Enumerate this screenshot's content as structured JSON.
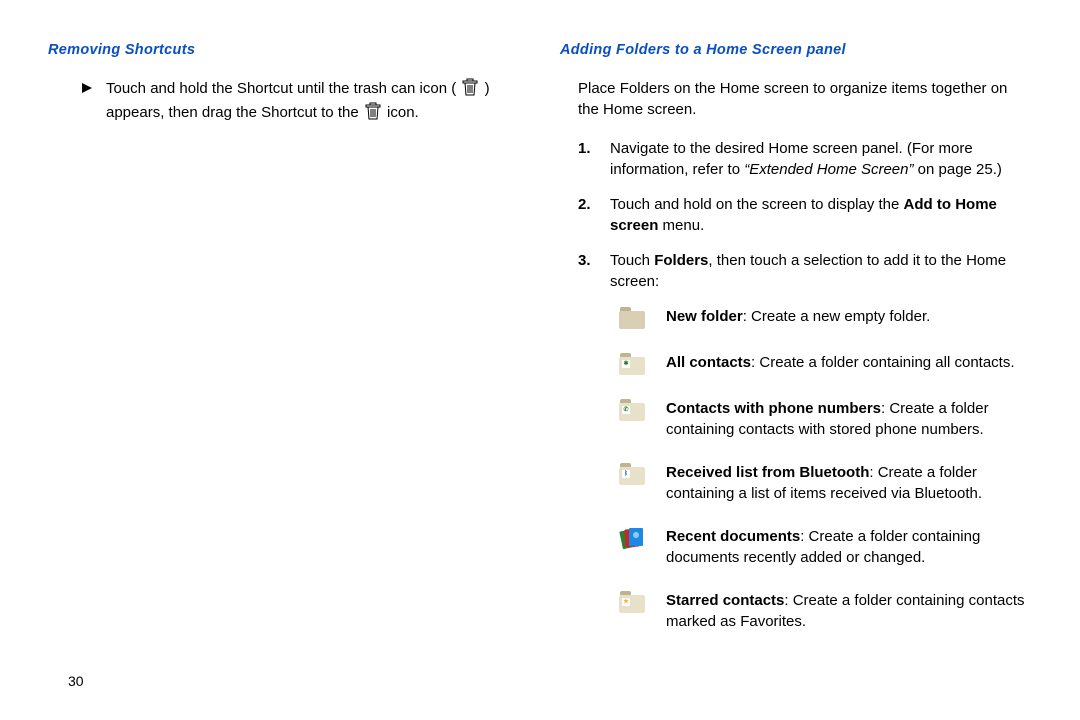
{
  "page_number": "30",
  "left": {
    "heading": "Removing Shortcuts",
    "bullet": {
      "pre": "Touch and hold the Shortcut until the trash can icon (",
      "mid": ") appears, then drag the Shortcut to the",
      "post": " icon."
    }
  },
  "right": {
    "heading": "Adding Folders to a Home Screen panel",
    "intro": "Place Folders on the Home screen to organize items together on the Home screen.",
    "steps": [
      {
        "num": "1.",
        "pre": "Navigate to the desired Home screen panel. (For more information, refer to ",
        "ref": "“Extended Home Screen”",
        "post": " on page 25.)"
      },
      {
        "num": "2.",
        "pre": "Touch and hold on the screen to display the ",
        "bold": "Add to Home screen",
        "post": " menu."
      },
      {
        "num": "3.",
        "pre": "Touch ",
        "bold": "Folders",
        "post": ", then touch a selection to add it to the Home screen:"
      }
    ],
    "folders": [
      {
        "title": "New folder",
        "desc": ": Create a new empty folder."
      },
      {
        "title": "All contacts",
        "desc": ": Create a folder containing all contacts."
      },
      {
        "title": "Contacts with phone numbers",
        "desc": ": Create a folder containing contacts with stored phone numbers."
      },
      {
        "title": "Received list from Bluetooth",
        "desc": ": Create a folder containing a list of items received via Bluetooth."
      },
      {
        "title": "Recent documents",
        "desc": ": Create a folder containing documents recently added or changed."
      },
      {
        "title": "Starred contacts",
        "desc": ": Create a folder containing contacts marked as Favorites."
      }
    ]
  }
}
